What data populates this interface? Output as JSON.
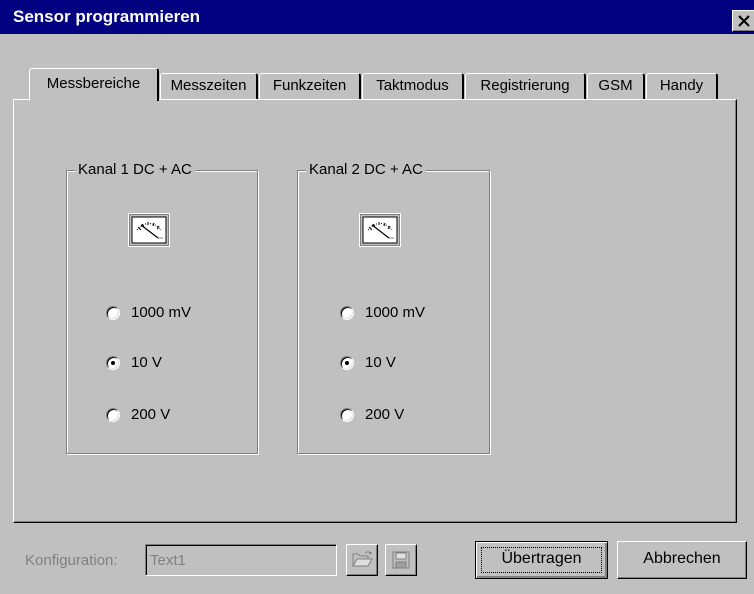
{
  "window": {
    "title": "Sensor programmieren",
    "close_glyph": "close-icon"
  },
  "tabs": [
    {
      "label": "Messbereiche",
      "active": true
    },
    {
      "label": "Messzeiten",
      "active": false
    },
    {
      "label": "Funkzeiten",
      "active": false
    },
    {
      "label": "Taktmodus",
      "active": false
    },
    {
      "label": "Registrierung",
      "active": false
    },
    {
      "label": "GSM",
      "active": false
    },
    {
      "label": "Handy",
      "active": false
    }
  ],
  "channels": [
    {
      "legend": "Kanal 1   DC + AC",
      "icon": "meter-icon",
      "options": [
        {
          "label": "1000 mV",
          "selected": false
        },
        {
          "label": "10 V",
          "selected": true
        },
        {
          "label": "200 V",
          "selected": false
        }
      ]
    },
    {
      "legend": "Kanal 2   DC + AC",
      "icon": "meter-icon",
      "options": [
        {
          "label": "1000 mV",
          "selected": false
        },
        {
          "label": "10 V",
          "selected": true
        },
        {
          "label": "200 V",
          "selected": false
        }
      ]
    }
  ],
  "footer": {
    "config_label": "Konfiguration:",
    "config_value": "Text1",
    "open_icon": "folder-open-icon",
    "save_icon": "floppy-disk-icon",
    "transfer_label": "Übertragen",
    "cancel_label": "Abbrechen"
  }
}
